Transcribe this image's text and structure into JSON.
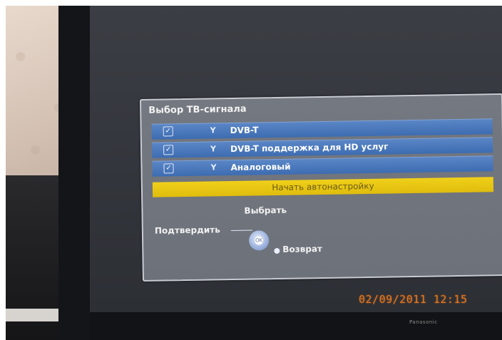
{
  "menu": {
    "title": "Выбор ТВ-сигнала",
    "options": [
      {
        "label": "DVB-T",
        "checked": true,
        "icon": "antenna-icon"
      },
      {
        "label": "DVB-T поддержка для HD услуг",
        "checked": true,
        "icon": "antenna-icon"
      },
      {
        "label": "Аналоговый",
        "checked": true,
        "icon": "antenna-icon"
      }
    ],
    "start_button": "Начать автонастройку",
    "hints": {
      "select": "Выбрать",
      "confirm": "Подтвердить",
      "back": "Возврат"
    },
    "remote_center": "OK"
  },
  "photo_timestamp": "02/09/2011  12:15",
  "brand": "Panasonic",
  "colors": {
    "option_blue": "#4a78bd",
    "start_yellow": "#e8c514",
    "timestamp_orange": "#e07722"
  }
}
